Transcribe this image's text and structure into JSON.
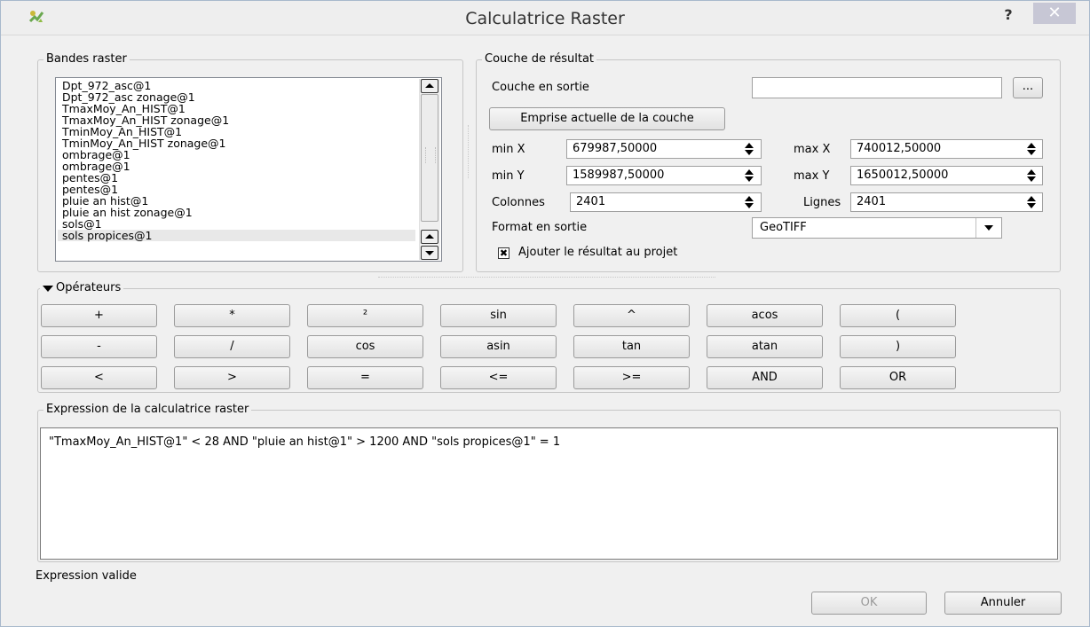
{
  "window": {
    "title": "Calculatrice Raster",
    "help_label": "?",
    "close_label": "✕"
  },
  "raster_bands": {
    "title": "Bandes raster",
    "items": [
      "Dpt_972_asc@1",
      "Dpt_972_asc zonage@1",
      "TmaxMoy_An_HIST@1",
      "TmaxMoy_An_HIST zonage@1",
      "TminMoy_An_HIST@1",
      "TminMoy_An_HIST zonage@1",
      "ombrage@1",
      "ombrage@1",
      "pentes@1",
      "pentes@1",
      "pluie an hist@1",
      "pluie an hist zonage@1",
      "sols@1",
      "sols propices@1"
    ]
  },
  "result_layer": {
    "title": "Couche de résultat",
    "output_layer_label": "Couche en sortie",
    "output_layer_value": "",
    "browse_label": "...",
    "extent_button": "Emprise actuelle de la couche",
    "min_x_label": "min X",
    "min_x_value": "679987,50000",
    "max_x_label": "max X",
    "max_x_value": "740012,50000",
    "min_y_label": "min Y",
    "min_y_value": "1589987,50000",
    "max_y_label": "max Y",
    "max_y_value": "1650012,50000",
    "columns_label": "Colonnes",
    "columns_value": "2401",
    "rows_label": "Lignes",
    "rows_value": "2401",
    "format_label": "Format en sortie",
    "format_value": "GeoTIFF",
    "add_result_label": "Ajouter le résultat au projet",
    "add_result_checked": true
  },
  "operators": {
    "title": "Opérateurs",
    "rows": [
      [
        "+",
        "*",
        "²",
        "sin",
        "^",
        "acos",
        "("
      ],
      [
        "-",
        "/",
        "cos",
        "asin",
        "tan",
        "atan",
        ")"
      ],
      [
        "<",
        ">",
        "=",
        "<=",
        ">=",
        "AND",
        "OR"
      ]
    ]
  },
  "expression": {
    "title": "Expression de la calculatrice raster",
    "value": "\"TmaxMoy_An_HIST@1\" < 28 AND \"pluie an hist@1\" > 1200 AND \"sols propices@1\" = 1"
  },
  "status": {
    "text": "Expression valide"
  },
  "footer": {
    "ok_label": "OK",
    "cancel_label": "Annuler"
  }
}
